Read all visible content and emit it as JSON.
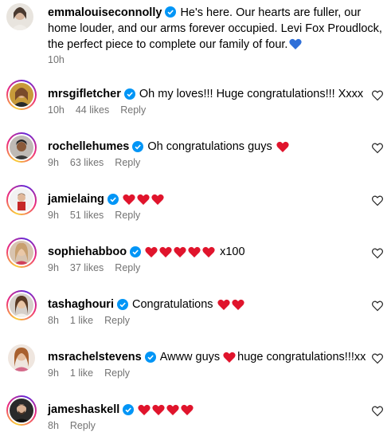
{
  "caption": {
    "username": "emmalouiseconnolly",
    "text": "He's here. Our hearts are fuller, our home louder, and our arms forever occupied. Levi Fox Proudlock, the perfect piece to complete our family of four.",
    "time": "10h"
  },
  "comments": [
    {
      "username": "mrsgifletcher",
      "text": "Oh my loves!!! Huge congratulations!!! Xxxx",
      "hearts_before": 0,
      "text_after": "",
      "time": "10h",
      "likes": "44 likes",
      "reply": "Reply"
    },
    {
      "username": "rochellehumes",
      "text": "Oh congratulations guys",
      "hearts_after": 1,
      "time": "9h",
      "likes": "63 likes",
      "reply": "Reply"
    },
    {
      "username": "jamielaing",
      "text": "",
      "hearts_after": 3,
      "time": "9h",
      "likes": "51 likes",
      "reply": "Reply"
    },
    {
      "username": "sophiehabboo",
      "text": "",
      "hearts_after": 5,
      "text_after": "x100",
      "time": "9h",
      "likes": "37 likes",
      "reply": "Reply"
    },
    {
      "username": "tashaghouri",
      "text": "Congratulations",
      "hearts_after": 2,
      "time": "8h",
      "likes": "1 like",
      "reply": "Reply"
    },
    {
      "username": "msrachelstevens",
      "text": "Awww guys",
      "hearts_after": 1,
      "text_after": "huge congratulations!!!xx",
      "time": "9h",
      "likes": "1 like",
      "reply": "Reply"
    },
    {
      "username": "jameshaskell",
      "text": "",
      "hearts_after": 4,
      "time": "8h",
      "likes": "",
      "reply": "Reply"
    }
  ],
  "colors": {
    "verified": "#0095f6",
    "heart_emoji": "#e0142c",
    "blue_heart": "#2f6fd8",
    "meta": "#737373"
  },
  "icons": {
    "verified": "verified-badge-icon",
    "like": "heart-outline-icon"
  }
}
